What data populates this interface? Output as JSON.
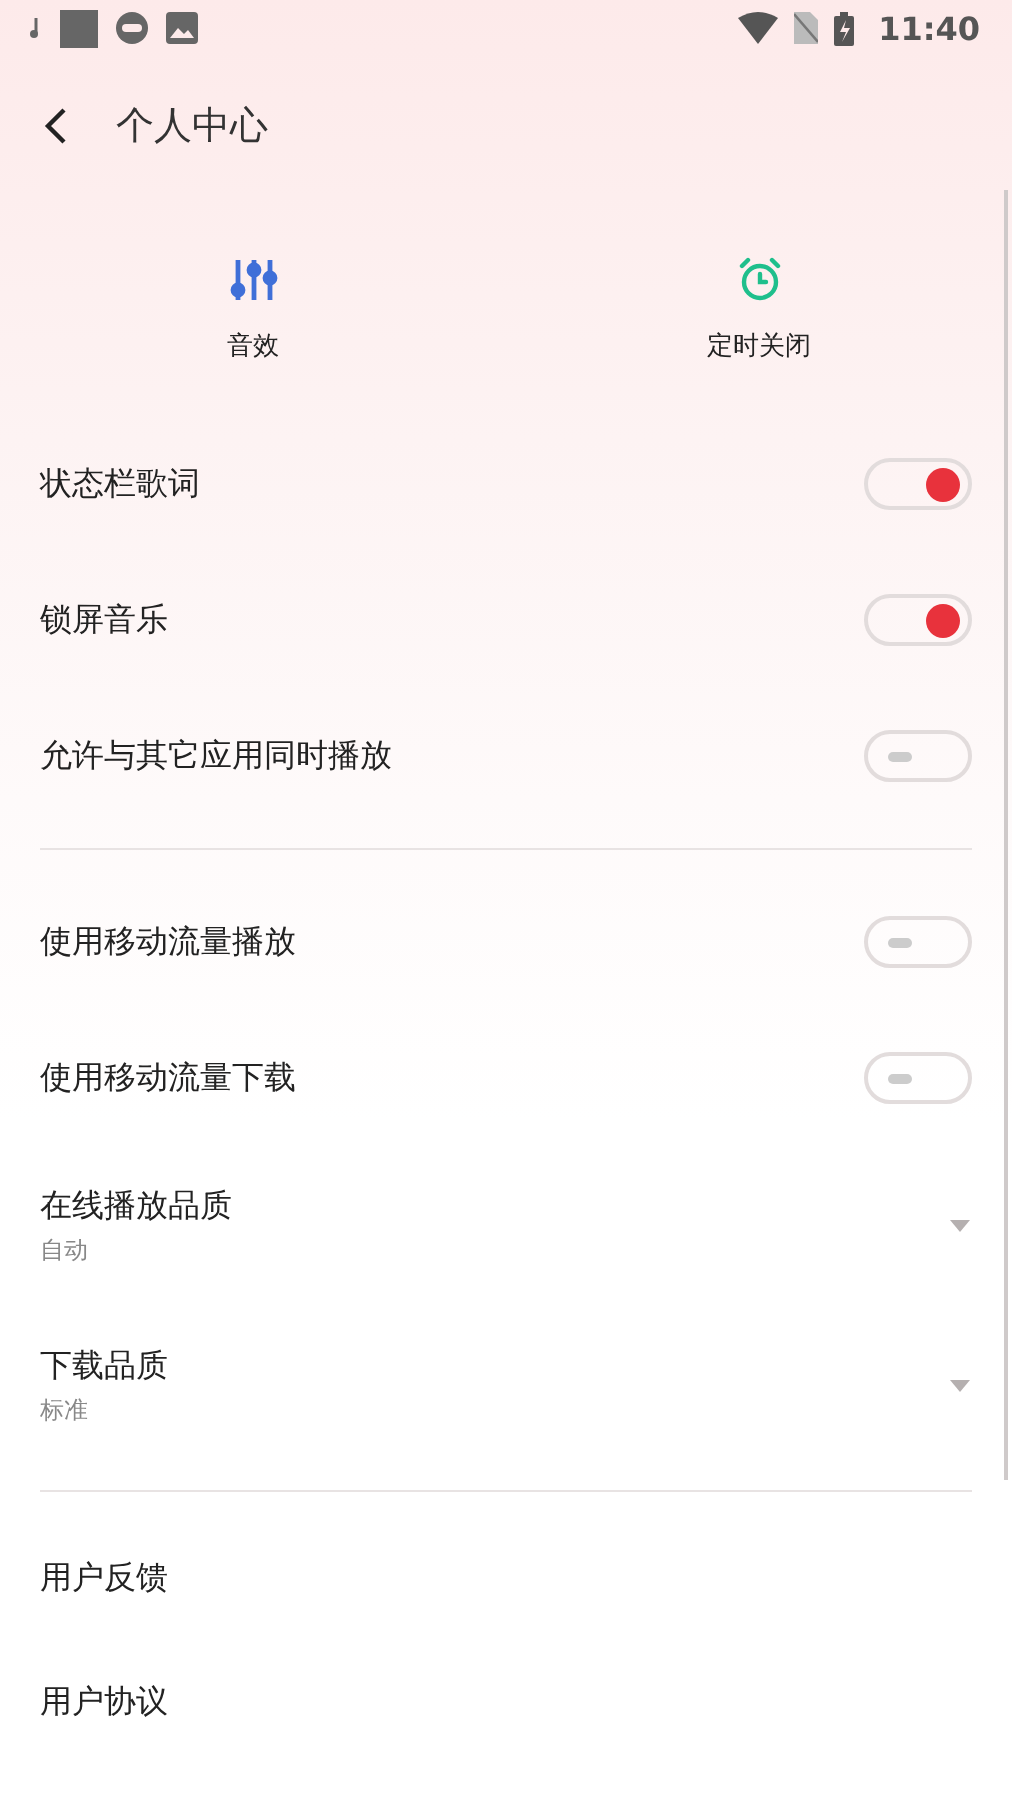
{
  "status_bar": {
    "time": "11:40"
  },
  "header": {
    "title": "个人中心"
  },
  "quick_actions": [
    {
      "label": "音效",
      "kind": "equalizer"
    },
    {
      "label": "定时关闭",
      "kind": "alarm"
    }
  ],
  "sections": [
    {
      "items": [
        {
          "kind": "toggle",
          "label": "状态栏歌词",
          "on": true
        },
        {
          "kind": "toggle",
          "label": "锁屏音乐",
          "on": true
        },
        {
          "kind": "toggle",
          "label": "允许与其它应用同时播放",
          "on": false
        }
      ]
    },
    {
      "items": [
        {
          "kind": "toggle",
          "label": "使用移动流量播放",
          "on": false
        },
        {
          "kind": "toggle",
          "label": "使用移动流量下载",
          "on": false
        },
        {
          "kind": "select",
          "label": "在线播放品质",
          "value": "自动"
        },
        {
          "kind": "select",
          "label": "下载品质",
          "value": "标准"
        }
      ]
    },
    {
      "items": [
        {
          "kind": "link",
          "label": "用户反馈"
        },
        {
          "kind": "link",
          "label": "用户协议"
        }
      ]
    }
  ]
}
